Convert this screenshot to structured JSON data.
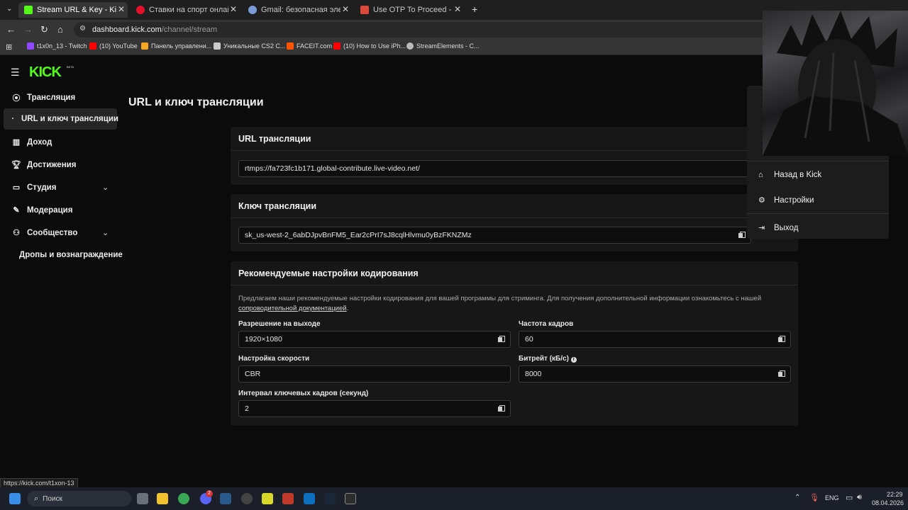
{
  "browser": {
    "tabs": [
      {
        "title": "Stream URL & Key - Kick Dashb",
        "fav": "#53fc18"
      },
      {
        "title": "Ставки на спорт онлайн — на",
        "fav": "#e2102a"
      },
      {
        "title": "Gmail: безопасная электронна",
        "fav": "#7a9ad6"
      },
      {
        "title": "Use OTP To Proceed - mockovs",
        "fav": "#d94a3a"
      }
    ],
    "address_host": "dashboard.kick.com",
    "address_path": "/channel/stream",
    "bookmarks": [
      {
        "label": "t1x0n_13 - Twitch",
        "color": "#9146ff"
      },
      {
        "label": "(10) YouTube",
        "color": "#ff0000"
      },
      {
        "label": "Панель управлени...",
        "color": "#f5a623"
      },
      {
        "label": "Уникальные CS2 С...",
        "color": "#cccccc"
      },
      {
        "label": "FACEIT.com",
        "color": "#ff5500"
      },
      {
        "label": "(10) How to Use iPh...",
        "color": "#ff0000"
      },
      {
        "label": "StreamElements - C...",
        "color": "#bbbbbb"
      }
    ],
    "status_url": "https://kick.com/t1xon-13"
  },
  "brand": {
    "logo": "KICK",
    "beta": "BETA"
  },
  "sidebar": {
    "items": [
      {
        "label": "Трансляция",
        "icon": "broadcast-icon"
      },
      {
        "label": "URL и ключ трансляции",
        "icon": "dot-icon"
      },
      {
        "label": "Доход",
        "icon": "chart-icon"
      },
      {
        "label": "Достижения",
        "icon": "trophy-icon"
      },
      {
        "label": "Студия",
        "icon": "studio-icon"
      },
      {
        "label": "Модерация",
        "icon": "wrench-icon"
      },
      {
        "label": "Сообщество",
        "icon": "people-icon"
      },
      {
        "label": "Дропы и вознаграждение",
        "icon": ""
      }
    ]
  },
  "page": {
    "title": "URL и ключ трансляции"
  },
  "stream_url": {
    "header": "URL трансляции",
    "value": "rtmps://fa723fc1b171.global-contribute.live-video.net/"
  },
  "stream_key": {
    "header": "Ключ трансляции",
    "value": "sk_us-west-2_6abDJpvBnFM5_Ear2cPrI7sJ8cqlHlvmu0yBzFKNZMz"
  },
  "encoding": {
    "header": "Рекомендуемые настройки кодирования",
    "desc_prefix": "Предлагаем наши рекомендуемые настройки кодирования для вашей программы для стриминга. Для получения дополнительной информации ознакомьтесь с нашей",
    "desc_link": "сопроводительной документацией",
    "desc_suffix": ".",
    "resolution_label": "Разрешение на выходе",
    "resolution": "1920×1080",
    "fps_label": "Частота кадров",
    "fps": "60",
    "rate_label": "Настройка скорости",
    "rate": "CBR",
    "bitrate_label": "Битрейт (кБ/с)",
    "bitrate": "8000",
    "keyframe_label": "Интервал ключевых кадров (секунд)",
    "keyframe": "2"
  },
  "dropdown": {
    "back": "Назад в Kick",
    "settings": "Настройки",
    "logout": "Выход"
  },
  "taskbar": {
    "search": "Поиск",
    "lang": "ENG",
    "time": "22:29",
    "date": "08.04.2026",
    "discord_badge": "2"
  }
}
